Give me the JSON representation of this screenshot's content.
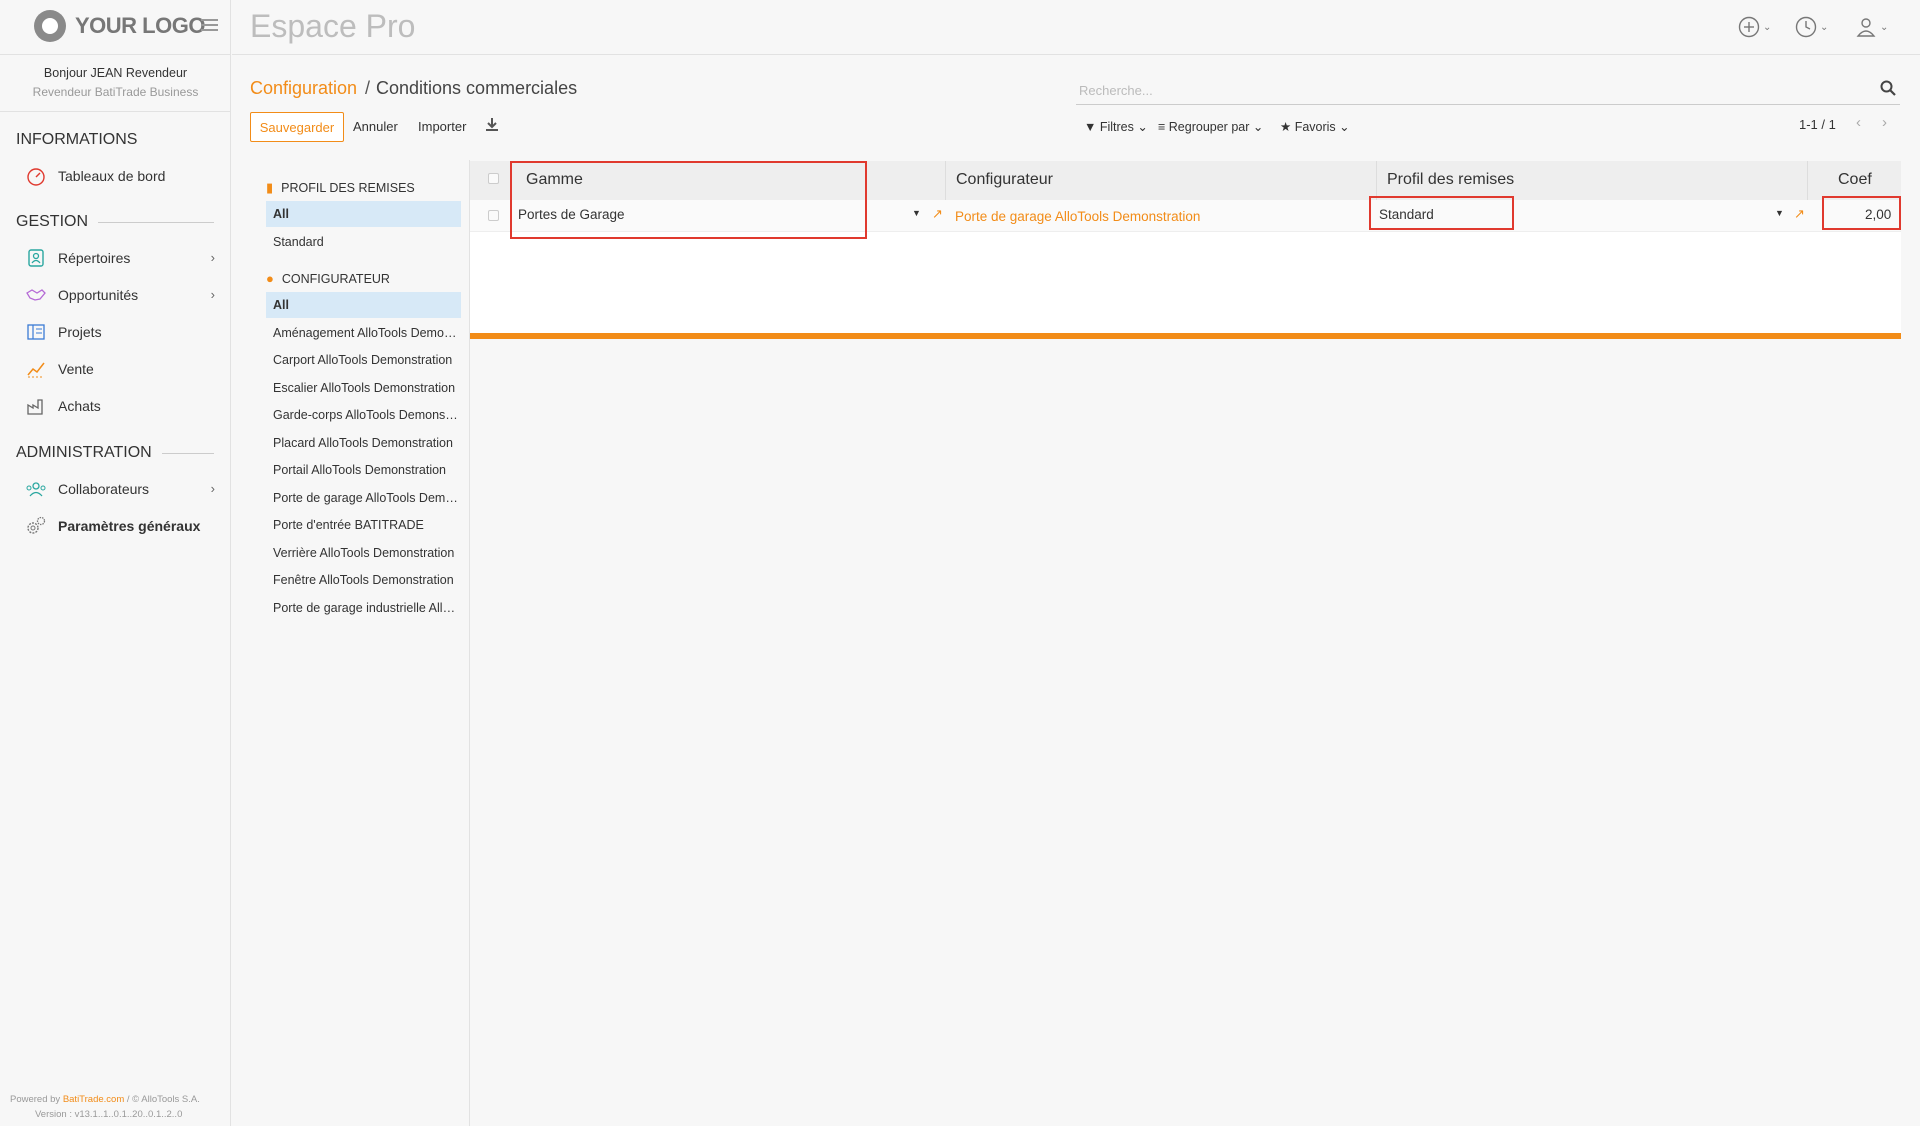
{
  "sidebar": {
    "logo_text": "YOUR LOGO",
    "greeting": "Bonjour JEAN Revendeur",
    "role": "Revendeur BatiTrade Business",
    "sections": {
      "informations": "INFORMATIONS",
      "gestion": "GESTION",
      "administration": "ADMINISTRATION"
    },
    "items": {
      "tableaux": "Tableaux de bord",
      "repertoires": "Répertoires",
      "opportunites": "Opportunités",
      "projets": "Projets",
      "vente": "Vente",
      "achats": "Achats",
      "collaborateurs": "Collaborateurs",
      "parametres": "Paramètres généraux"
    },
    "footer": {
      "powered_prefix": "Powered by",
      "powered_brand": "BatiTrade.com",
      "powered_suffix": "/ © AlloTools S.A.",
      "version": "Version : v13.1..1..0.1..20..0.1..2..0"
    }
  },
  "topbar": {
    "title": "Espace Pro"
  },
  "breadcrumb": {
    "parent": "Configuration",
    "separator": "/",
    "current": "Conditions commerciales"
  },
  "toolbar": {
    "save": "Sauvegarder",
    "cancel": "Annuler",
    "import": "Importer"
  },
  "search": {
    "placeholder": "Recherche..."
  },
  "filters": {
    "filtres": "Filtres",
    "regrouper": "Regrouper par",
    "favoris": "Favoris"
  },
  "pager": {
    "text": "1-1 / 1"
  },
  "searchpanel": {
    "profil_header": "PROFIL DES REMISES",
    "profil_items": [
      "All",
      "Standard"
    ],
    "config_header": "CONFIGURATEUR",
    "config_items": [
      "All",
      "Aménagement AlloTools Demonstration",
      "Carport AlloTools Demonstration",
      "Escalier AlloTools Demonstration",
      "Garde-corps AlloTools Demonstration",
      "Placard AlloTools Demonstration",
      "Portail AlloTools Demonstration",
      "Porte de garage AlloTools Demonstration",
      "Porte d'entrée BATITRADE",
      "Verrière AlloTools Demonstration",
      "Fenêtre AlloTools Demonstration",
      "Porte de garage industrielle AlloTools"
    ]
  },
  "table": {
    "columns": {
      "gamme": "Gamme",
      "configurateur": "Configurateur",
      "profil": "Profil des remises",
      "coef": "Coef"
    },
    "row": {
      "gamme": "Portes de Garage",
      "configurateur": "Porte de garage AlloTools Demonstration",
      "profil": "Standard",
      "coef": "2,00"
    }
  },
  "colors": {
    "accent": "#f28c18",
    "highlight": "#e0392e",
    "active_bg": "#d7e9f7"
  }
}
